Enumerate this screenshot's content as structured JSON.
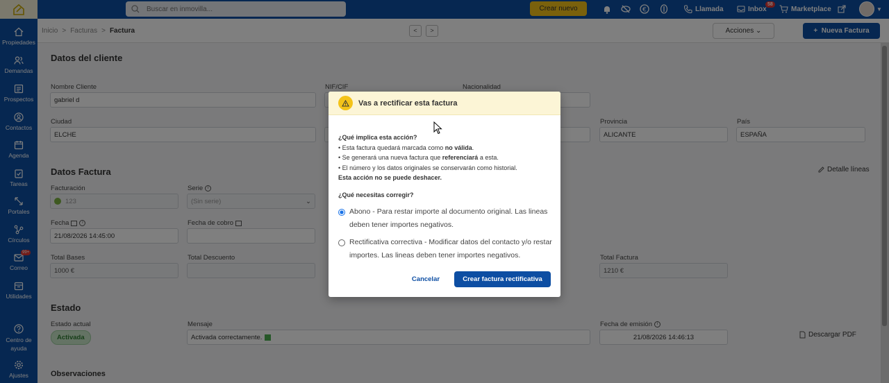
{
  "topbar": {
    "search_placeholder": "Buscar en inmovilla...",
    "crear_label": "Crear nuevo",
    "llamada_label": "Llamada",
    "inbox_label": "Inbox",
    "inbox_count": "58",
    "marketplace_label": "Marketplace"
  },
  "sidebar": {
    "items": [
      {
        "label": "Propiedades",
        "icon": "home-icon"
      },
      {
        "label": "Demandas",
        "icon": "users-icon"
      },
      {
        "label": "Prospectos",
        "icon": "list-icon"
      },
      {
        "label": "Contactos",
        "icon": "contact-icon"
      },
      {
        "label": "Agenda",
        "icon": "calendar-icon"
      },
      {
        "label": "Tareas",
        "icon": "tasks-icon"
      },
      {
        "label": "Portales",
        "icon": "portals-icon"
      },
      {
        "label": "Círculos",
        "icon": "circles-icon"
      },
      {
        "label": "Correo",
        "icon": "mail-icon"
      },
      {
        "label": "Utilidades",
        "icon": "tools-icon"
      },
      {
        "label": "Centro de ayuda",
        "icon": "help-icon"
      },
      {
        "label": "Ajustes",
        "icon": "settings-icon"
      }
    ],
    "correo_badge": "99+"
  },
  "subheader": {
    "crumbs": [
      "Inicio",
      "Facturas",
      "Factura"
    ],
    "acciones_label": "Acciones",
    "nueva_factura_label": "Nueva Factura"
  },
  "cliente": {
    "title": "Datos del cliente",
    "nombre_label": "Nombre Cliente",
    "nombre_value": "gabriel d",
    "nif_label": "NIF/CIF",
    "nacionalidad_label": "Nacionalidad",
    "ciudad_label": "Ciudad",
    "ciudad_value": "ELCHE",
    "provincia_label": "Provincia",
    "provincia_value": "ALICANTE",
    "pais_label": "País",
    "pais_value": "ESPAÑA"
  },
  "factura": {
    "title": "Datos Factura",
    "detalle_label": "Detalle líneas",
    "facturacion_label": "Facturación",
    "facturacion_value": "123",
    "serie_label": "Serie",
    "serie_value": "(Sin serie)",
    "fecha_label": "Fecha",
    "fecha_value": "21/08/2026 14:45:00",
    "fecha_cobro_label": "Fecha de cobro",
    "total_bases_label": "Total Bases",
    "total_bases_value": "1000 €",
    "total_descuento_label": "Total Descuento",
    "total_factura_label": "Total Factura",
    "total_factura_value": "1210 €"
  },
  "estado": {
    "title": "Estado",
    "actual_label": "Estado actual",
    "actual_value": "Activada",
    "mensaje_label": "Mensaje",
    "mensaje_value": "Activada correctamente.",
    "fecha_emision_label": "Fecha de emisión",
    "fecha_emision_value": "21/08/2026 14:46:13",
    "descargar_label": "Descargar PDF"
  },
  "observaciones_title": "Observaciones",
  "modal": {
    "title": "Vas a rectificar esta factura",
    "q1": "¿Qué implica esta acción?",
    "b1_pre": "Esta factura quedará marcada como ",
    "b1_bold": "no válida",
    "b1_post": ".",
    "b2_pre": "Se generará una nueva factura que ",
    "b2_bold": "referenciará",
    "b2_post": " a esta.",
    "b3": "El número y los datos originales se conservarán como historial.",
    "warning": "Esta acción no se puede deshacer.",
    "q2": "¿Qué necesitas corregir?",
    "option1": "Abono - Para restar importe al documento original. Las lineas deben tener importes negativos.",
    "option2": "Rectificativa correctiva - Modificar datos del contacto y/o restar importes. Las lineas deben tener importes negativos.",
    "cancel_label": "Cancelar",
    "confirm_label": "Crear factura rectificativa"
  }
}
